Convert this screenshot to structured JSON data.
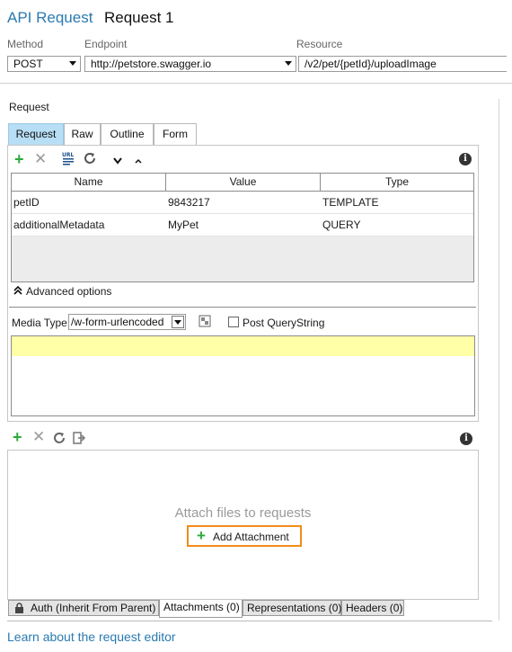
{
  "header": {
    "type_label": "API Request",
    "request_name": "Request 1"
  },
  "fields": {
    "method_label": "Method",
    "method_value": "POST",
    "endpoint_label": "Endpoint",
    "endpoint_value": "http://petstore.swagger.io",
    "resource_label": "Resource",
    "resource_value": "/v2/pet/{petId}/uploadImage"
  },
  "request": {
    "section_label": "Request",
    "tabs": [
      {
        "label": "Request",
        "active": true
      },
      {
        "label": "Raw",
        "active": false
      },
      {
        "label": "Outline",
        "active": false
      },
      {
        "label": "Form",
        "active": false
      }
    ],
    "toolbar_icons": [
      "add-icon",
      "delete-icon",
      "encode-icon",
      "refresh-icon",
      "move-down-icon",
      "move-up-icon",
      "info-icon"
    ],
    "columns": [
      "Name",
      "Value",
      "Type"
    ],
    "rows": [
      {
        "name": "petID",
        "value": "9843217",
        "type": "TEMPLATE"
      },
      {
        "name": "additionalMetadata",
        "value": "MyPet",
        "type": "QUERY"
      }
    ],
    "advanced_options": "Advanced options",
    "media_type_label": "Media Type",
    "media_type_value": "/w-form-urlencoded",
    "post_querystring_label": "Post QueryString",
    "post_querystring_checked": false
  },
  "attachments": {
    "toolbar_icons": [
      "add-icon",
      "delete-icon",
      "reload-icon",
      "export-icon",
      "info-icon"
    ],
    "empty_text": "Attach files to requests",
    "add_button": "Add Attachment",
    "add_button_border": "#f28c1a"
  },
  "bottom_tabs": [
    {
      "label": "Auth (Inherit From Parent)",
      "icon": "lock-icon",
      "active": false
    },
    {
      "label": "Attachments (0)",
      "active": true
    },
    {
      "label": "Representations (0)",
      "active": false
    },
    {
      "label": "Headers (0)",
      "active": false
    }
  ],
  "footer": {
    "link": "Learn about the request editor"
  },
  "colors": {
    "accent": "#2a7ab0",
    "active_tab": "#b7def5",
    "highlight_row": "#ffffa8",
    "green": "#2eaa3a"
  }
}
